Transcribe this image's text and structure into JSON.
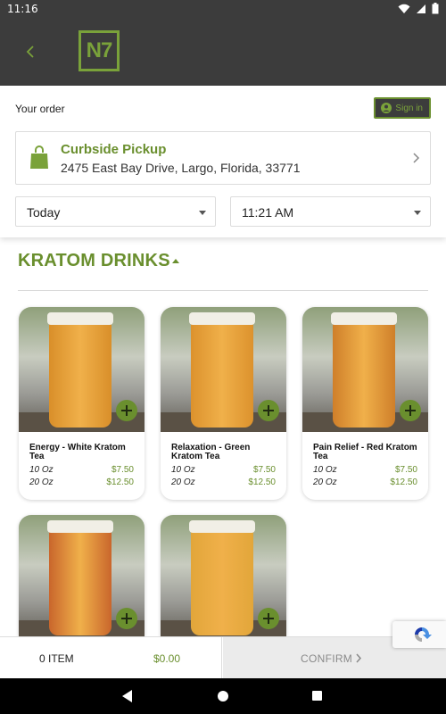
{
  "status_bar": {
    "time": "11:16"
  },
  "header": {
    "logo_text": "N7"
  },
  "order": {
    "your_order_label": "Your order",
    "sign_in_label": "Sign in",
    "pickup_title": "Curbside Pickup",
    "pickup_address": "2475 East Bay Drive, Largo, Florida, 33771",
    "day_value": "Today",
    "time_value": "11:21 AM"
  },
  "category": {
    "title": "KRATOM DRINKS"
  },
  "products": [
    {
      "name": "Energy - White Kratom Tea",
      "prices": [
        {
          "size": "10 Oz",
          "price": "$7.50"
        },
        {
          "size": "20 Oz",
          "price": "$12.50"
        }
      ],
      "drink_color": "#d98f2a"
    },
    {
      "name": "Relaxation - Green Kratom Tea",
      "prices": [
        {
          "size": "10 Oz",
          "price": "$7.50"
        },
        {
          "size": "20 Oz",
          "price": "$12.50"
        }
      ],
      "drink_color": "#dc922d"
    },
    {
      "name": "Pain Relief - Red Kratom Tea",
      "prices": [
        {
          "size": "10 Oz",
          "price": "$7.50"
        },
        {
          "size": "20 Oz",
          "price": "$12.50"
        }
      ],
      "drink_color": "#cf7f2a"
    },
    {
      "name": "",
      "prices": [],
      "drink_color": "#c9662c"
    },
    {
      "name": "",
      "prices": [],
      "drink_color": "#e2a63a"
    }
  ],
  "cart": {
    "item_count": "0 ITEM",
    "total": "$0.00",
    "confirm_label": "CONFIRM"
  },
  "colors": {
    "brand_green": "#6a8f2e",
    "header_dark": "#3c3c3c"
  },
  "icons": [
    "wifi-icon",
    "signal-icon",
    "battery-icon",
    "back-arrow-icon",
    "user-icon",
    "shopping-bag-icon",
    "chevron-right-icon",
    "chevron-down-icon",
    "plus-icon",
    "recaptcha-icon",
    "nav-back-icon",
    "nav-home-icon",
    "nav-recent-icon"
  ]
}
